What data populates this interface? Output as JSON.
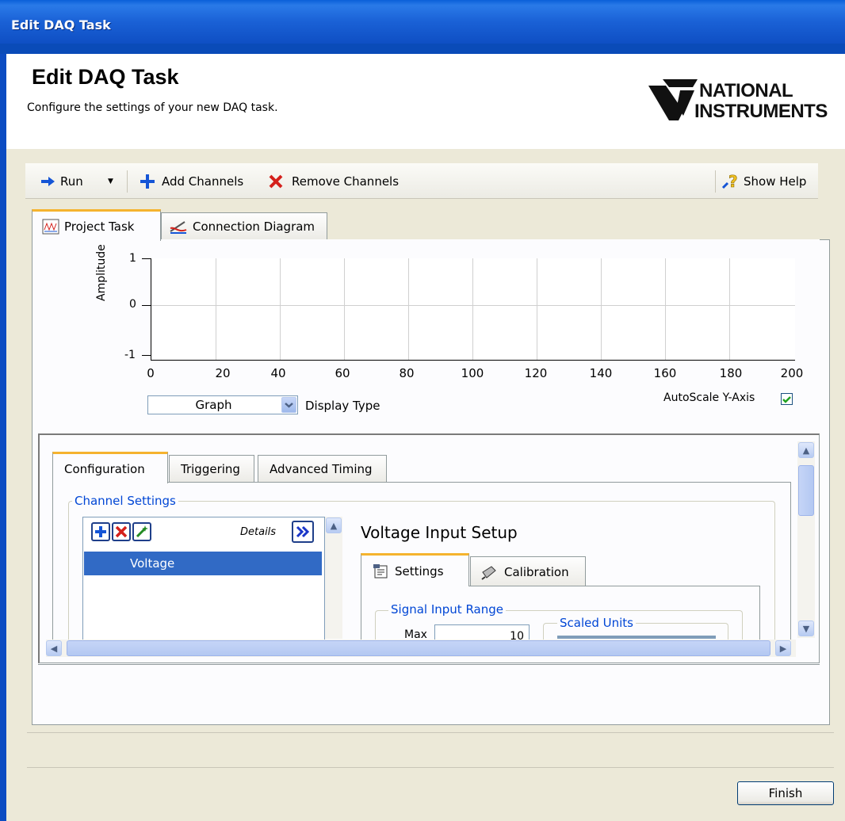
{
  "window": {
    "title": "Edit DAQ Task"
  },
  "header": {
    "title": "Edit DAQ Task",
    "subtitle": "Configure the settings of your new DAQ task.",
    "logo_line1": "NATIONAL",
    "logo_line2": "INSTRUMENTS"
  },
  "toolbar": {
    "run_label": "Run",
    "add_channels_label": "Add Channels",
    "remove_channels_label": "Remove Channels",
    "show_help_label": "Show Help"
  },
  "main_tabs": [
    {
      "label": "Project Task",
      "active": true
    },
    {
      "label": "Connection Diagram",
      "active": false
    }
  ],
  "graph": {
    "ylabel": "Amplitude",
    "yticks": [
      "1",
      "0",
      "-1"
    ],
    "xticks": [
      "0",
      "20",
      "40",
      "60",
      "80",
      "100",
      "120",
      "140",
      "160",
      "180",
      "200"
    ],
    "display_type_value": "Graph",
    "display_type_label": "Display Type",
    "autoscale_label": "AutoScale Y-Axis",
    "autoscale_checked": true
  },
  "config_tabs": [
    {
      "label": "Configuration",
      "active": true
    },
    {
      "label": "Triggering",
      "active": false
    },
    {
      "label": "Advanced Timing",
      "active": false
    }
  ],
  "channel_settings": {
    "group_label": "Channel Settings",
    "details_label": "Details",
    "channels": [
      "Voltage"
    ]
  },
  "voltage_setup": {
    "title": "Voltage Input Setup",
    "tabs": [
      {
        "label": "Settings",
        "active": true
      },
      {
        "label": "Calibration",
        "active": false
      }
    ],
    "signal_input_range_label": "Signal Input Range",
    "max_label": "Max",
    "max_value": "10",
    "scaled_units_label": "Scaled Units"
  },
  "footer": {
    "finish_label": "Finish"
  },
  "colors": {
    "accent": "#f5b32e",
    "title_blue": "#0a5fd9",
    "selection": "#316ac5",
    "group_label": "#0046d5"
  }
}
